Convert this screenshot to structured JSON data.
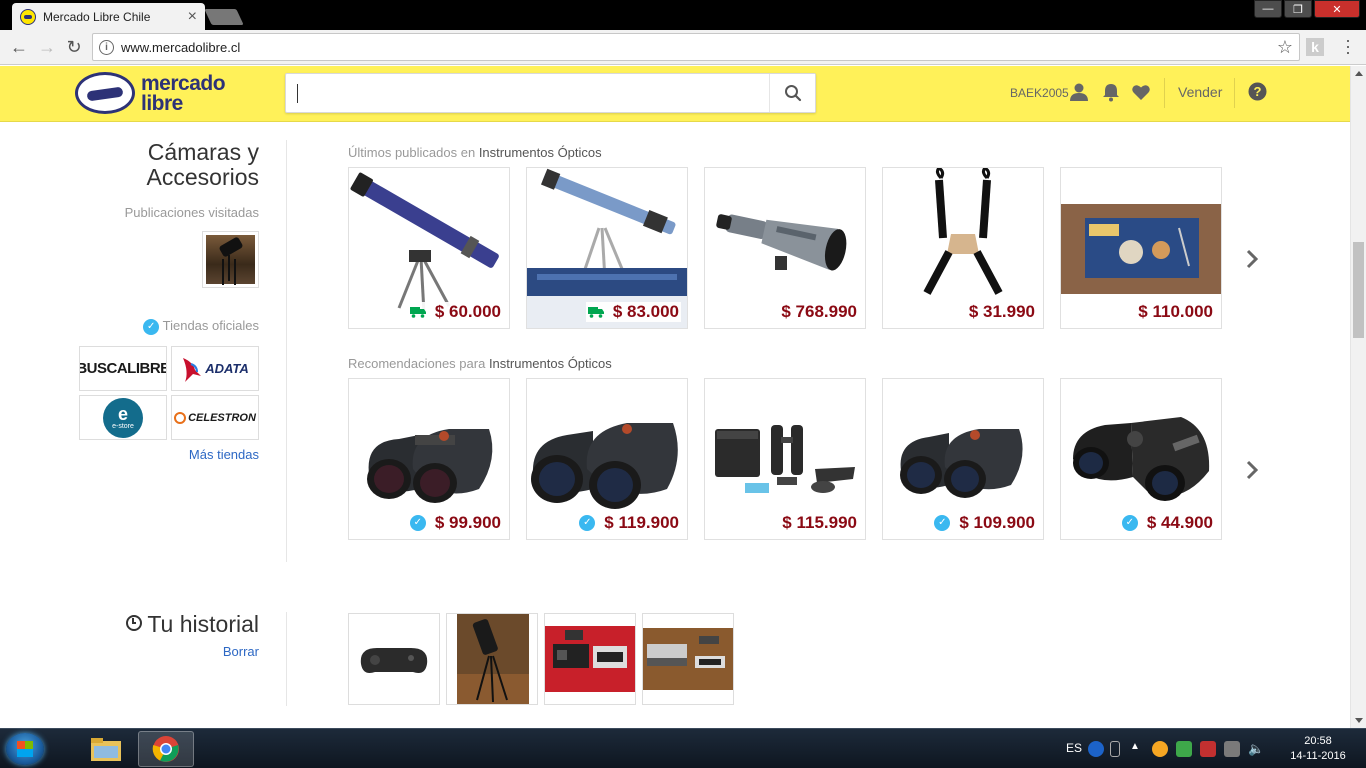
{
  "browser": {
    "tab_title": "Mercado Libre Chile",
    "tab_close": "×",
    "url": "www.mercadolibre.cl",
    "ext_label": "k"
  },
  "header": {
    "logo_line1": "mercado",
    "logo_line2": "libre",
    "search_placeholder": "",
    "username": "BAEK2005",
    "sell_label": "Vender"
  },
  "sidebar": {
    "category_title_line1": "Cámaras y",
    "category_title_line2": "Accesorios",
    "visited_label": "Publicaciones visitadas",
    "official_stores_label": "Tiendas oficiales",
    "stores": [
      "BUSCALIBRE",
      "ADATA",
      "e-store",
      "CELESTRON"
    ],
    "more_stores": "Más tiendas"
  },
  "latest": {
    "title_prefix": "Últimos publicados en",
    "title_category": "Instrumentos Ópticos",
    "items": [
      {
        "price": "$ 60.000",
        "badge": "truck"
      },
      {
        "price": "$ 83.000",
        "badge": "truck"
      },
      {
        "price": "$ 768.990",
        "badge": ""
      },
      {
        "price": "$ 31.990",
        "badge": ""
      },
      {
        "price": "$ 110.000",
        "badge": ""
      }
    ]
  },
  "recommended": {
    "title_prefix": "Recomendaciones para",
    "title_category": "Instrumentos Ópticos",
    "items": [
      {
        "price": "$ 99.900",
        "badge": "check"
      },
      {
        "price": "$ 119.900",
        "badge": "check"
      },
      {
        "price": "$ 115.990",
        "badge": ""
      },
      {
        "price": "$ 109.900",
        "badge": "check"
      },
      {
        "price": "$ 44.900",
        "badge": "check"
      }
    ]
  },
  "history": {
    "title": "Tu historial",
    "clear_label": "Borrar"
  },
  "taskbar": {
    "language": "ES",
    "time": "20:58",
    "date": "14-11-2016"
  },
  "colors": {
    "header_bg": "#fff159",
    "brand_blue": "#2d3277",
    "price": "#8b0a14",
    "link": "#2d68c4",
    "verified": "#3ab8f0",
    "truck": "#00a650"
  }
}
